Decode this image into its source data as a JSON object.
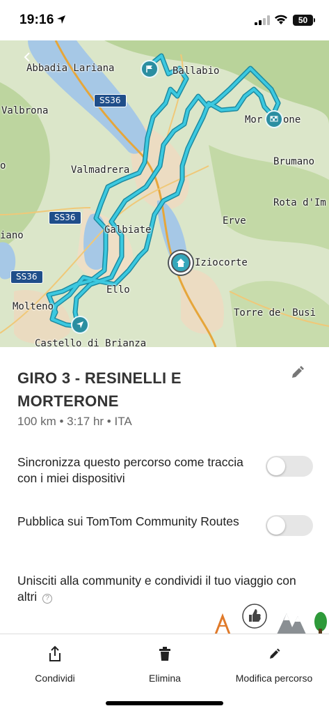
{
  "status_bar": {
    "time": "19:16",
    "battery": "50"
  },
  "map": {
    "places": [
      "Abbadia Lariana",
      "Ballabio",
      "Valbrona",
      "Valmadrera",
      "Galbiate",
      "Erve",
      "Brumano",
      "Rota d'Im",
      "Ello",
      "Molteno",
      "Castello di Brianza",
      "Torre de' Busi",
      "Iziocorte",
      "iano",
      "o"
    ],
    "morterone_left": "Mor",
    "morterone_right": "one",
    "roads": [
      "SS36",
      "SS36",
      "SS36"
    ],
    "route_color": "#35c3dc",
    "marker_color": "#2b8ea1"
  },
  "route": {
    "title": "GIRO 3 - RESINELLI E MORTERONE",
    "meta": "100 km • 3:17 hr • ITA"
  },
  "settings": {
    "sync_label": "Sincronizza questo percorso come traccia con i miei dispositivi",
    "sync_on": false,
    "publish_label": "Pubblica sui TomTom Community Routes",
    "publish_on": false
  },
  "community": {
    "text": "Unisciti alla community e condividi il tuo viaggio con altri",
    "help": "?"
  },
  "actions": {
    "share": "Condividi",
    "delete": "Elimina",
    "edit": "Modifica percorso"
  }
}
